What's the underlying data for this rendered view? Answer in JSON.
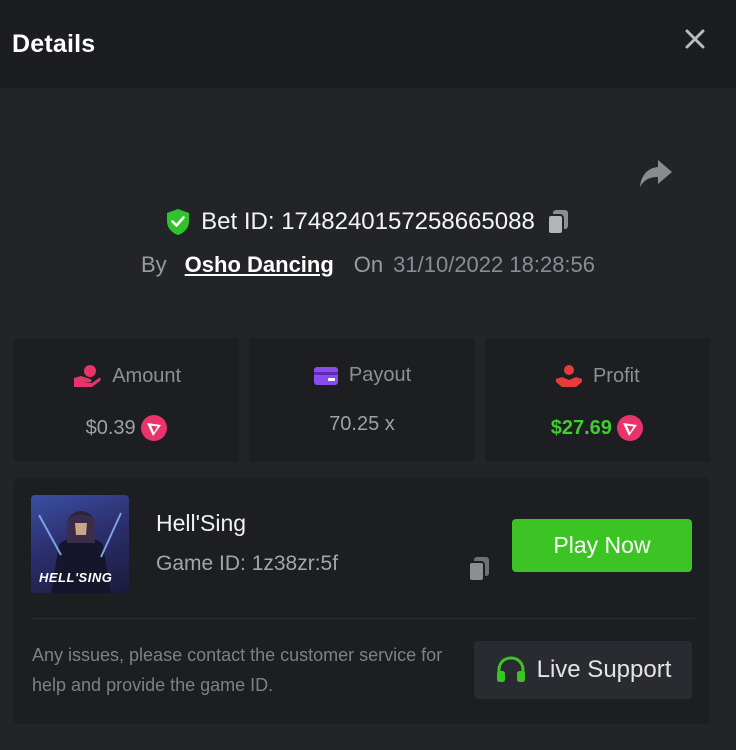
{
  "header": {
    "title": "Details",
    "close_icon": "close-icon"
  },
  "bet": {
    "share_icon": "share-arrow-icon",
    "verified_icon": "shield-check-icon",
    "bet_id_label": "Bet ID: 1748240157258665088",
    "copy_icon": "copy-icon",
    "by_label": "By",
    "username": "Osho Dancing",
    "on_label": "On",
    "datetime": "31/10/2022 18:28:56"
  },
  "stats": [
    {
      "icon": "hand-coin-icon",
      "label": "Amount",
      "value": "$0.39",
      "coin_icon": "tron-coin-icon",
      "color": "#e8336b"
    },
    {
      "icon": "wallet-card-icon",
      "label": "Payout",
      "value": "70.25 x",
      "color": "#8a4cf0"
    },
    {
      "icon": "profit-hand-icon",
      "label": "Profit",
      "value": "$27.69",
      "coin_icon": "tron-coin-icon",
      "color": "#e63c3c"
    }
  ],
  "game": {
    "thumbnail_title": "HELL'SING",
    "name": "Hell'Sing",
    "game_id": "Game ID: 1z38zr:5f",
    "copy_icon": "copy-icon",
    "play_label": "Play Now",
    "help_text": "Any issues, please contact the customer service for help and provide the game ID.",
    "support_label": "Live Support",
    "support_icon": "headset-icon"
  },
  "colors": {
    "accent_green": "#3cc324",
    "profit_green": "#3ccf2e",
    "background": "#232428",
    "panel": "#1d1e22"
  }
}
